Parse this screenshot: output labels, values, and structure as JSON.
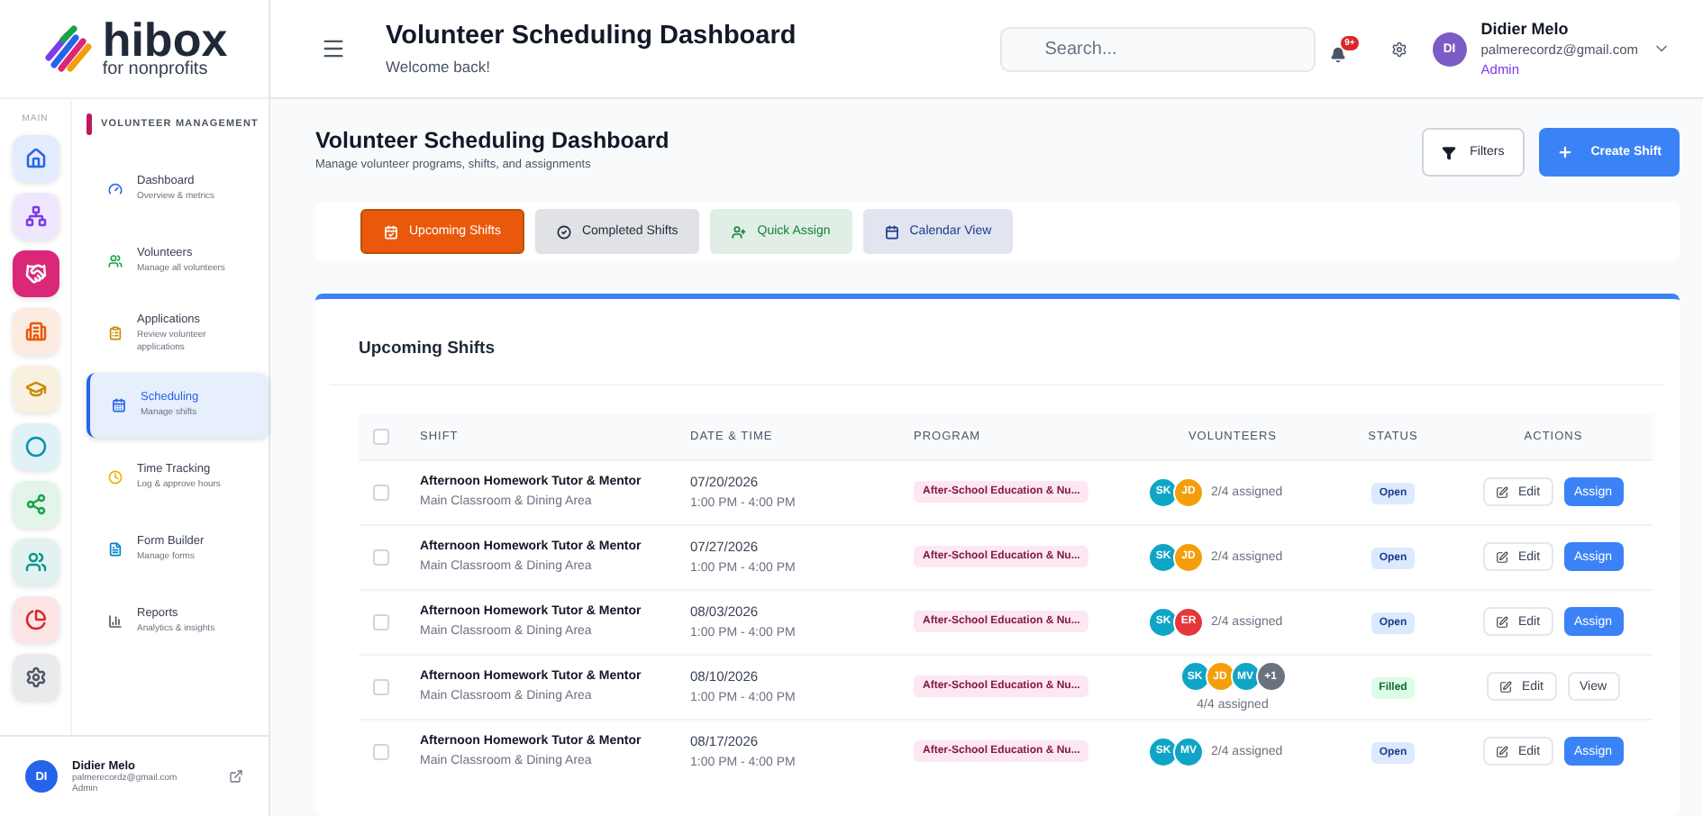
{
  "logo": {
    "name": "hibox",
    "tagline": "for nonprofits"
  },
  "rail": {
    "label": "MAIN",
    "items": [
      {
        "kind": "home",
        "color": "#2563eb",
        "selected": false
      },
      {
        "kind": "org",
        "color": "#7c3aed",
        "selected": false
      },
      {
        "kind": "handshake",
        "color": "#db2777",
        "selected": true
      },
      {
        "kind": "building",
        "color": "#ea580c",
        "selected": false
      },
      {
        "kind": "cap",
        "color": "#ca8a04",
        "selected": false
      },
      {
        "kind": "circle",
        "color": "#0891b2",
        "selected": false
      },
      {
        "kind": "network",
        "color": "#16a34a",
        "selected": false
      },
      {
        "kind": "users",
        "color": "#0d9488",
        "selected": false
      },
      {
        "kind": "pie",
        "color": "#dc2626",
        "selected": false
      },
      {
        "kind": "gear",
        "color": "#4b5563",
        "selected": false
      }
    ]
  },
  "nav": {
    "section": "VOLUNTEER MANAGEMENT",
    "items": [
      {
        "kind": "dashboard",
        "title": "Dashboard",
        "subtitle": "Overview & metrics",
        "selected": false
      },
      {
        "kind": "volunteers",
        "title": "Volunteers",
        "subtitle": "Manage all volunteers",
        "selected": false
      },
      {
        "kind": "applications",
        "title": "Applications",
        "subtitle": "Review volunteer applications",
        "selected": false
      },
      {
        "kind": "scheduling",
        "title": "Scheduling",
        "subtitle": "Manage shifts",
        "selected": true
      },
      {
        "kind": "time",
        "title": "Time Tracking",
        "subtitle": "Log & approve hours",
        "selected": false
      },
      {
        "kind": "forms",
        "title": "Form Builder",
        "subtitle": "Manage forms",
        "selected": false
      },
      {
        "kind": "reports",
        "title": "Reports",
        "subtitle": "Analytics & insights",
        "selected": false
      }
    ]
  },
  "sidebar_user": {
    "initials": "DI",
    "name": "Didier Melo",
    "email": "palmerecordz@gmail.com",
    "role": "Admin"
  },
  "header": {
    "title": "Volunteer Scheduling Dashboard",
    "subtitle": "Welcome back!",
    "search": {
      "placeholder": "Search..."
    },
    "notifications": "9+",
    "user": {
      "initials": "DI",
      "name": "Didier Melo",
      "email": "palmerecordz@gmail.com",
      "role": "Admin"
    }
  },
  "page": {
    "title": "Volunteer Scheduling Dashboard",
    "subtitle": "Manage volunteer programs, shifts, and assignments",
    "filters": "Filters",
    "create": "Create Shift"
  },
  "tabs": [
    {
      "kind": "upcoming",
      "label": "Upcoming Shifts",
      "color": "#ea580c",
      "selected": true
    },
    {
      "kind": "completed",
      "label": "Completed Shifts",
      "color": "#1e293b",
      "selected": false
    },
    {
      "kind": "assign",
      "label": "Quick Assign",
      "color": "#15803d",
      "selected": false
    },
    {
      "kind": "calendar",
      "label": "Calendar View",
      "color": "#1e3a8a",
      "selected": false
    }
  ],
  "table": {
    "title": "Upcoming Shifts",
    "header_checked": false,
    "columns": [
      "SHIFT",
      "DATE & TIME",
      "PROGRAM",
      "VOLUNTEERS",
      "STATUS",
      "ACTIONS"
    ],
    "rows": [
      {
        "checked": false,
        "shift": "Afternoon Homework Tutor & Mentor",
        "location": "Main Classroom & Dining Area",
        "date": "07/20/2026",
        "time": "1:00 PM - 4:00 PM",
        "program": "After-School Education & Nu...",
        "volunteers": [
          {
            "initials": "SK",
            "color": "#0ea5c6"
          },
          {
            "initials": "JD",
            "color": "#f59e0b"
          }
        ],
        "assigned": "2/4 assigned",
        "status": {
          "kind": "open",
          "label": "Open"
        },
        "actions": [
          {
            "kind": "edit",
            "label": "Edit"
          },
          {
            "kind": "assign",
            "label": "Assign"
          }
        ]
      },
      {
        "checked": false,
        "shift": "Afternoon Homework Tutor & Mentor",
        "location": "Main Classroom & Dining Area",
        "date": "07/27/2026",
        "time": "1:00 PM - 4:00 PM",
        "program": "After-School Education & Nu...",
        "volunteers": [
          {
            "initials": "SK",
            "color": "#0ea5c6"
          },
          {
            "initials": "JD",
            "color": "#f59e0b"
          }
        ],
        "assigned": "2/4 assigned",
        "status": {
          "kind": "open",
          "label": "Open"
        },
        "actions": [
          {
            "kind": "edit",
            "label": "Edit"
          },
          {
            "kind": "assign",
            "label": "Assign"
          }
        ]
      },
      {
        "checked": false,
        "shift": "Afternoon Homework Tutor & Mentor",
        "location": "Main Classroom & Dining Area",
        "date": "08/03/2026",
        "time": "1:00 PM - 4:00 PM",
        "program": "After-School Education & Nu...",
        "volunteers": [
          {
            "initials": "SK",
            "color": "#0ea5c6"
          },
          {
            "initials": "ER",
            "color": "#e5383b"
          }
        ],
        "assigned": "2/4 assigned",
        "status": {
          "kind": "open",
          "label": "Open"
        },
        "actions": [
          {
            "kind": "edit",
            "label": "Edit"
          },
          {
            "kind": "assign",
            "label": "Assign"
          }
        ]
      },
      {
        "checked": false,
        "shift": "Afternoon Homework Tutor & Mentor",
        "location": "Main Classroom & Dining Area",
        "date": "08/10/2026",
        "time": "1:00 PM - 4:00 PM",
        "program": "After-School Education & Nu...",
        "volunteers": [
          {
            "initials": "SK",
            "color": "#0ea5c6"
          },
          {
            "initials": "JD",
            "color": "#f59e0b"
          },
          {
            "initials": "MV",
            "color": "#0ea5c6"
          },
          {
            "initials": "+1",
            "color": "#6b7280"
          }
        ],
        "assigned": "4/4 assigned",
        "status": {
          "kind": "filled",
          "label": "Filled"
        },
        "actions": [
          {
            "kind": "edit",
            "label": "Edit"
          },
          {
            "kind": "view",
            "label": "View"
          }
        ]
      },
      {
        "checked": false,
        "shift": "Afternoon Homework Tutor & Mentor",
        "location": "Main Classroom & Dining Area",
        "date": "08/17/2026",
        "time": "1:00 PM - 4:00 PM",
        "program": "After-School Education & Nu...",
        "volunteers": [
          {
            "initials": "SK",
            "color": "#0ea5c6"
          },
          {
            "initials": "MV",
            "color": "#0ea5c6"
          }
        ],
        "assigned": "2/4 assigned",
        "status": {
          "kind": "open",
          "label": "Open"
        },
        "actions": [
          {
            "kind": "edit",
            "label": "Edit"
          },
          {
            "kind": "assign",
            "label": "Assign"
          }
        ]
      }
    ]
  }
}
